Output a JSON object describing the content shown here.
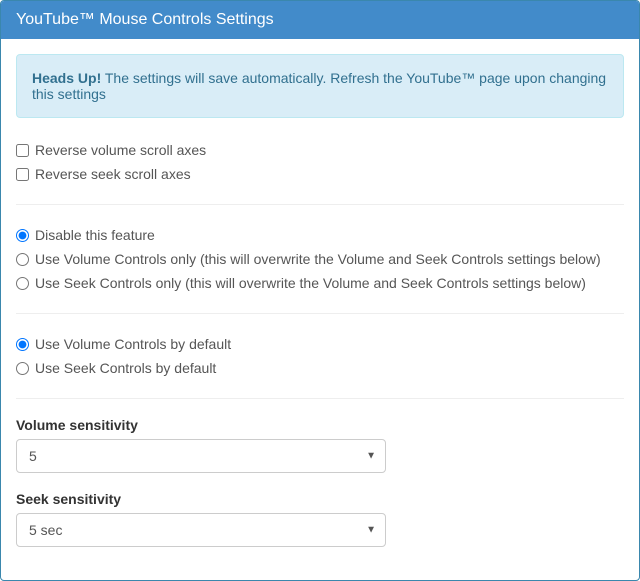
{
  "panel": {
    "title": "YouTube™ Mouse Controls Settings"
  },
  "alert": {
    "strong": "Heads Up!",
    "text": " The settings will save automatically. Refresh the YouTube™ page upon changing this settings"
  },
  "reverse": {
    "volume": "Reverse volume scroll axes",
    "seek": "Reverse seek scroll axes"
  },
  "feature_mode": {
    "disable": "Disable this feature",
    "volume_only": "Use Volume Controls only (this will overwrite the Volume and Seek Controls settings below)",
    "seek_only": "Use Seek Controls only (this will overwrite the Volume and Seek Controls settings below)"
  },
  "default_mode": {
    "volume": "Use Volume Controls by default",
    "seek": "Use Seek Controls by default"
  },
  "volume_sensitivity": {
    "label": "Volume sensitivity",
    "value": "5"
  },
  "seek_sensitivity": {
    "label": "Seek sensitivity",
    "value": "5 sec"
  }
}
